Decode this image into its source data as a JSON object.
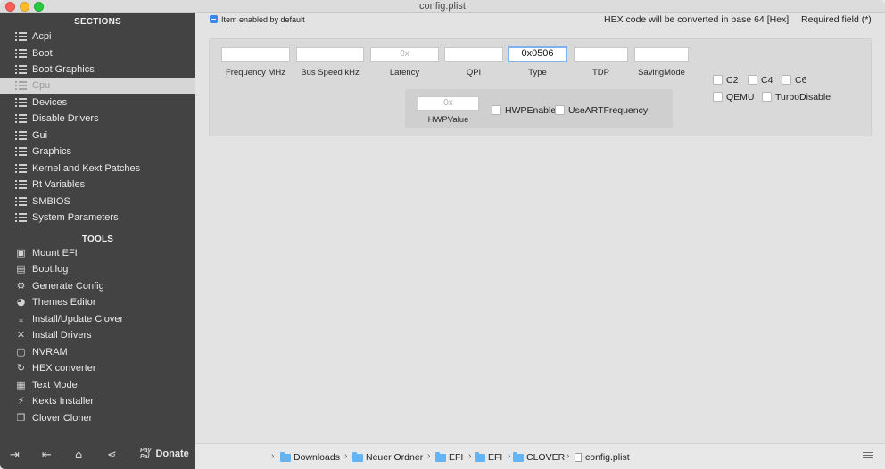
{
  "window": {
    "title": "config.plist"
  },
  "sidebar": {
    "sections_heading": "SECTIONS",
    "sections": [
      {
        "label": "Acpi"
      },
      {
        "label": "Boot"
      },
      {
        "label": "Boot Graphics"
      },
      {
        "label": "Cpu",
        "selected": true
      },
      {
        "label": "Devices"
      },
      {
        "label": "Disable Drivers"
      },
      {
        "label": "Gui"
      },
      {
        "label": "Graphics"
      },
      {
        "label": "Kernel and Kext Patches"
      },
      {
        "label": "Rt Variables"
      },
      {
        "label": "SMBIOS"
      },
      {
        "label": "System Parameters"
      }
    ],
    "tools_heading": "TOOLS",
    "tools": [
      {
        "label": "Mount EFI",
        "icon": "disk-icon"
      },
      {
        "label": "Boot.log",
        "icon": "log-icon"
      },
      {
        "label": "Generate Config",
        "icon": "gears-icon"
      },
      {
        "label": "Themes Editor",
        "icon": "palette-icon"
      },
      {
        "label": "Install/Update Clover",
        "icon": "download-icon"
      },
      {
        "label": "Install Drivers",
        "icon": "wrench-icon"
      },
      {
        "label": "NVRAM",
        "icon": "chip-icon"
      },
      {
        "label": "HEX converter",
        "icon": "refresh-icon"
      },
      {
        "label": "Text Mode",
        "icon": "text-icon"
      },
      {
        "label": "Kexts Installer",
        "icon": "plug-icon"
      },
      {
        "label": "Clover Cloner",
        "icon": "clone-icon"
      }
    ],
    "bottom": {
      "paypal_top": "Pay",
      "paypal_bottom": "Pal",
      "donate_label": "Donate"
    }
  },
  "topbar": {
    "item_enabled_label": "Item enabled by default",
    "hex_note": "HEX code will be converted in base 64 [Hex]",
    "required_note": "Required field (*)"
  },
  "cpu": {
    "fields": [
      {
        "label": "Frequency MHz",
        "value": "",
        "placeholder": ""
      },
      {
        "label": "Bus Speed kHz",
        "value": "",
        "placeholder": ""
      },
      {
        "label": "Latency",
        "value": "",
        "placeholder": "0x"
      },
      {
        "label": "QPI",
        "value": "",
        "placeholder": ""
      },
      {
        "label": "Type",
        "value": "0x0506",
        "placeholder": ""
      },
      {
        "label": "TDP",
        "value": "",
        "placeholder": ""
      },
      {
        "label": "SavingMode",
        "value": "",
        "placeholder": ""
      }
    ],
    "hwp": {
      "label": "HWPValue",
      "placeholder": "0x",
      "hwp_enable": "HWPEnable",
      "use_art": "UseARTFrequency"
    },
    "checkboxes": {
      "c2": "C2",
      "c4": "C4",
      "c6": "C6",
      "qemu": "QEMU",
      "turbo": "TurboDisable"
    }
  },
  "pathbar": {
    "crumbs": [
      "Downloads",
      "Neuer Ordner",
      "EFI",
      "EFI",
      "CLOVER",
      "config.plist"
    ]
  },
  "colors": {
    "sidebar_bg": "#434343",
    "selected_bg": "#d6d6d6",
    "accent": "#3a86ea",
    "folder": "#63b4f5"
  }
}
